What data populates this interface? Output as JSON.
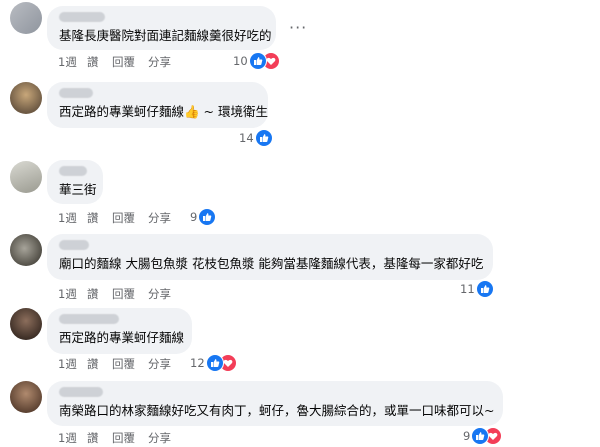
{
  "actions": {
    "reply": "讚",
    "like_label": "讚",
    "reply_label": "回覆",
    "share_label": "分享"
  },
  "more_label": "···",
  "comments": [
    {
      "time": "1週",
      "text": "基隆長庚醫院對面連記麵線羹很好吃的",
      "count": "10",
      "reactions": [
        "like",
        "love"
      ]
    },
    {
      "time": "1週",
      "text": "西定路的專業蚵仔麵線👍 ~ 環境衛生",
      "count": "14",
      "reactions": [
        "like"
      ]
    },
    {
      "time": "1週",
      "text": "華三街",
      "count": "9",
      "reactions": [
        "like"
      ]
    },
    {
      "time": "1週",
      "text": "廟口的麵線 大腸包魚漿 花枝包魚漿 能夠當基隆麵線代表，基隆每一家都好吃",
      "count": "11",
      "reactions": [
        "like"
      ]
    },
    {
      "time": "1週",
      "text": "西定路的專業蚵仔麵線",
      "count": "12",
      "reactions": [
        "like",
        "love"
      ]
    },
    {
      "time": "1週",
      "text": "南榮路口的林家麵線好吃又有肉丁，蚵仔，魯大腸綜合的，或單一口味都可以~",
      "count": "9",
      "reactions": [
        "like",
        "love"
      ]
    }
  ],
  "colors": {
    "like": "#1877f2",
    "love": "#f33e58",
    "bubble": "#f0f2f5",
    "meta": "#65676b"
  }
}
